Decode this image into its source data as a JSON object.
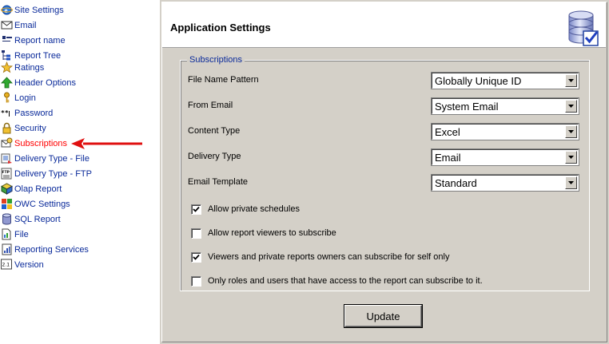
{
  "sidebar": {
    "items": [
      {
        "label": "Site Settings",
        "icon": "ie-globe-icon"
      },
      {
        "label": "Email",
        "icon": "envelope-icon"
      },
      {
        "label": "Report name",
        "icon": "label-tag-icon"
      },
      {
        "label": "Report Tree",
        "icon": "tree-icon"
      },
      {
        "label": "Ratings",
        "icon": "star-icon"
      },
      {
        "label": "Header Options",
        "icon": "green-up-arrow-icon"
      },
      {
        "label": "Login",
        "icon": "key-icon"
      },
      {
        "label": "Password",
        "icon": "password-dots-icon"
      },
      {
        "label": "Security",
        "icon": "padlock-icon"
      },
      {
        "label": "Subscriptions",
        "icon": "subscription-icon"
      },
      {
        "label": "Delivery Type - File",
        "icon": "file-delivery-icon"
      },
      {
        "label": "Delivery Type - FTP",
        "icon": "ftp-icon"
      },
      {
        "label": "Olap Report",
        "icon": "cube-icon"
      },
      {
        "label": "OWC Settings",
        "icon": "owc-icon"
      },
      {
        "label": "SQL Report",
        "icon": "database-icon"
      },
      {
        "label": "File",
        "icon": "document-icon"
      },
      {
        "label": "Reporting Services",
        "icon": "report-icon"
      },
      {
        "label": "Version",
        "icon": "version-icon"
      }
    ],
    "active_label": "Subscriptions"
  },
  "header": {
    "title": "Application Settings",
    "icon": "database-check-icon"
  },
  "subscriptions": {
    "legend": "Subscriptions",
    "fields": [
      {
        "label": "File Name Pattern",
        "value": "Globally Unique ID"
      },
      {
        "label": "From Email",
        "value": "System Email"
      },
      {
        "label": "Content Type",
        "value": "Excel"
      },
      {
        "label": "Delivery Type",
        "value": "Email"
      },
      {
        "label": "Email Template",
        "value": "Standard"
      }
    ],
    "checkboxes": [
      {
        "label": "Allow private schedules",
        "checked": true
      },
      {
        "label": "Allow report viewers to subscribe",
        "checked": false
      },
      {
        "label": "Viewers and private reports owners can subscribe for self only",
        "checked": true
      },
      {
        "label": "Only roles and users that have access to the report can subscribe to it.",
        "checked": false
      }
    ]
  },
  "actions": {
    "update_label": "Update"
  },
  "colors": {
    "link": "#0a2a9a",
    "active_link": "#ff0000",
    "annotation_arrow": "#e01010",
    "panel_bg": "#d4d0c8"
  }
}
